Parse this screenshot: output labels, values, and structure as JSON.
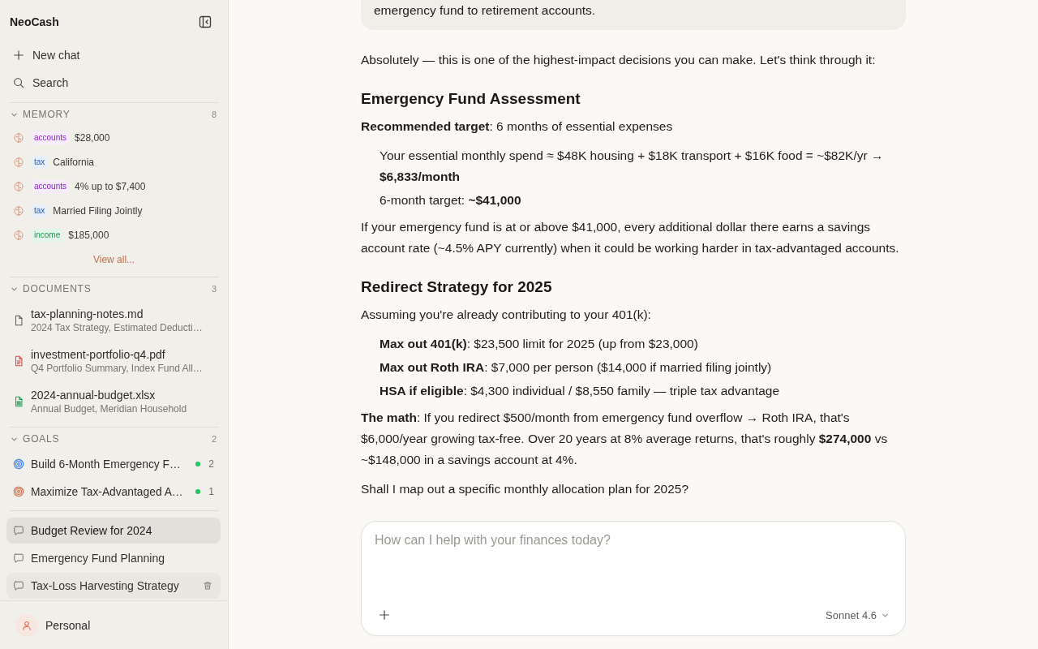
{
  "sidebar": {
    "app_name": "NeoCash",
    "actions": [
      {
        "kind": "new",
        "label": "New chat"
      },
      {
        "kind": "search",
        "label": "Search"
      }
    ],
    "memory": {
      "title": "MEMORY",
      "count": "8",
      "expanded": true,
      "items": [
        {
          "tag": "accounts",
          "color": "#f6ecfc",
          "value": "$28,000"
        },
        {
          "tag": "tax",
          "color": "#e9f0fc",
          "value": "California"
        },
        {
          "tag": "accounts",
          "color": "#f6ecfc",
          "value": "4% up to $7,400"
        },
        {
          "tag": "tax",
          "color": "#e9f0fc",
          "value": "Married Filing Jointly"
        },
        {
          "tag": "income",
          "color": "#e3f6ea",
          "value": "$185,000"
        }
      ],
      "view_all": "View all..."
    },
    "documents": {
      "title": "DOCUMENTS",
      "count": "3",
      "expanded": true,
      "items": [
        {
          "kind": "text",
          "name": "tax-planning-notes.md",
          "summary": "2024 Tax Strategy, Estimated Deducti…"
        },
        {
          "kind": "pdf",
          "name": "investment-portfolio-q4.pdf",
          "summary": "Q4 Portfolio Summary, Index Fund All…"
        },
        {
          "kind": "sheet",
          "name": "2024-annual-budget.xlsx",
          "summary": "Annual Budget, Meridian Household"
        }
      ]
    },
    "goals": {
      "title": "GOALS",
      "count": "2",
      "expanded": true,
      "items": [
        {
          "title": "Build 6-Month Emergency F…",
          "color": "#3b7ff2",
          "active": true,
          "count": "2"
        },
        {
          "title": "Maximize Tax-Advantaged A…",
          "color": "#d4704f",
          "active": true,
          "count": "1"
        }
      ]
    },
    "chats": [
      {
        "title": "Budget Review for 2024",
        "selected": true,
        "hovered": false
      },
      {
        "title": "Emergency Fund Planning",
        "selected": false,
        "hovered": false
      },
      {
        "title": "Tax-Loss Harvesting Strategy",
        "selected": false,
        "hovered": true
      }
    ],
    "account": {
      "label": "Personal"
    }
  },
  "conversation": {
    "user_message": "emergency fund to retirement accounts.",
    "assistant_blocks": [
      {
        "kind": "paragraph",
        "text": "Absolutely — this is one of the highest-impact decisions you can make. Let's think through it:"
      },
      {
        "kind": "heading",
        "text": "Emergency Fund Assessment"
      },
      {
        "kind": "paragraph",
        "text": "**Recommended target**: 6 months of essential expenses"
      },
      {
        "kind": "list",
        "items": [
          "Your essential monthly spend ≈ $48K housing + $18K transport + $16K food = ~$82K/yr → **$6,833/month**",
          "6-month target: **~$41,000**"
        ]
      },
      {
        "kind": "paragraph",
        "text": "If your emergency fund is at or above $41,000, every additional dollar there earns a savings account rate (~4.5% APY currently) when it could be working harder in tax-advantaged accounts."
      },
      {
        "kind": "heading",
        "text": "Redirect Strategy for 2025"
      },
      {
        "kind": "paragraph",
        "text": "Assuming you're already contributing to your 401(k):"
      },
      {
        "kind": "list",
        "items": [
          "**Max out 401(k)**: $23,500 limit for 2025 (up from $23,000)",
          "**Max out Roth IRA**: $7,000 per person ($14,000 if married filing jointly)",
          "**HSA if eligible**: $4,300 individual / $8,550 family — triple tax advantage"
        ]
      },
      {
        "kind": "paragraph",
        "text": "**The math**: If you redirect $500/month from emergency fund overflow → Roth IRA, that's $6,000/year growing tax-free. Over 20 years at 8% average returns, that's roughly **$274,000** vs ~$148,000 in a savings account at 4%."
      },
      {
        "kind": "paragraph",
        "text": "Shall I map out a specific monthly allocation plan for 2025?"
      }
    ]
  },
  "composer": {
    "placeholder": "How can I help with your finances today?",
    "model": "Sonnet 4.6"
  }
}
